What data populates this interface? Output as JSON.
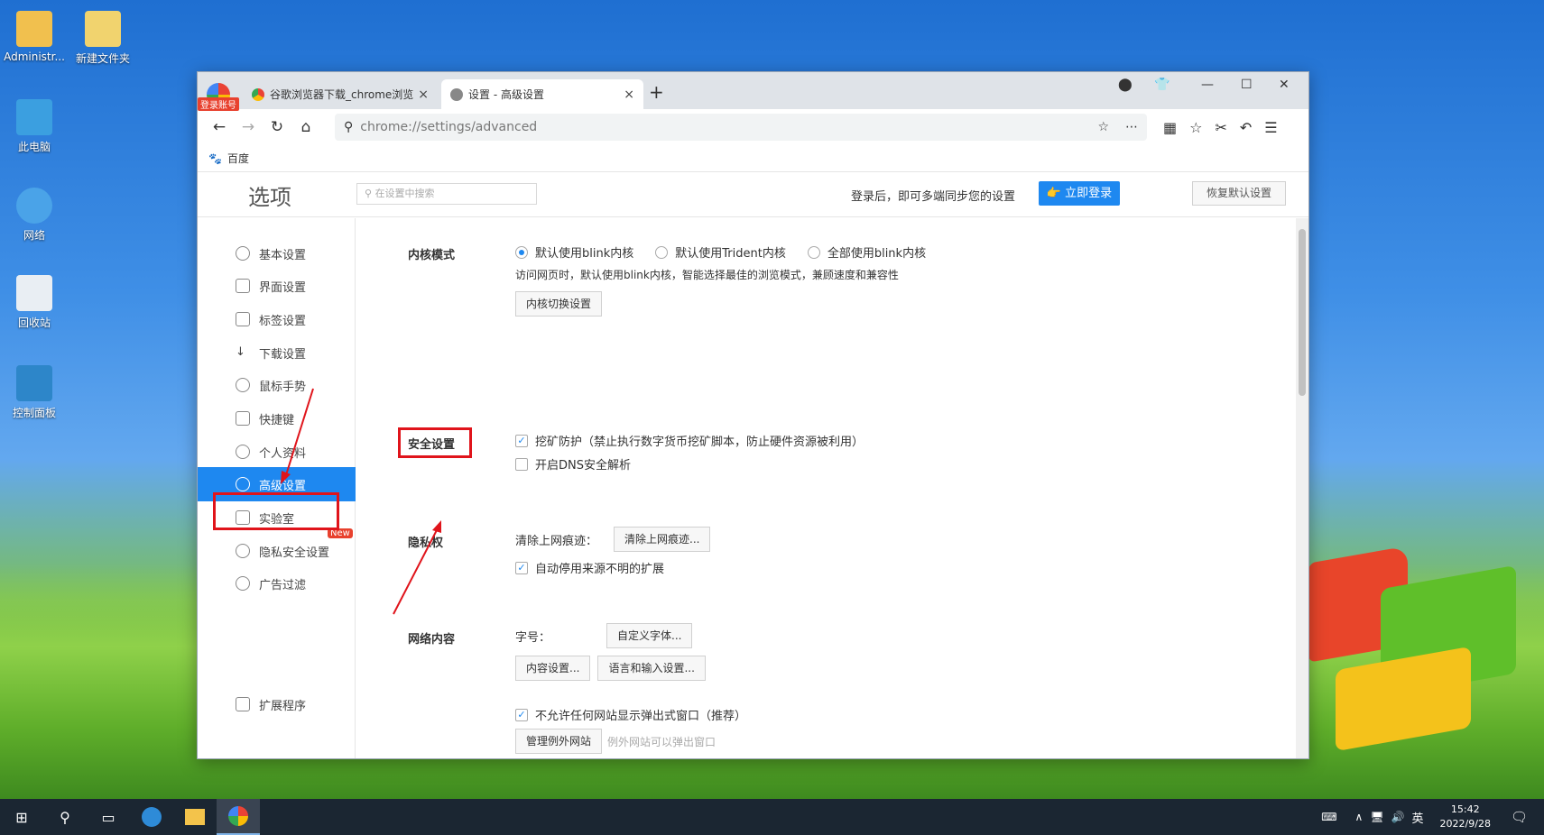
{
  "desktop": {
    "icons": [
      {
        "label": "Administr..."
      },
      {
        "label": "新建文件夹"
      },
      {
        "label": "此电脑"
      },
      {
        "label": "网络"
      },
      {
        "label": "回收站"
      },
      {
        "label": "控制面板"
      }
    ]
  },
  "browser": {
    "login_badge": "登录账号",
    "tabs": [
      {
        "title": "谷歌浏览器下载_chrome浏览",
        "close": "×"
      },
      {
        "title": "设置 - 高级设置",
        "close": "×"
      }
    ],
    "new_tab": "+",
    "address": "chrome://settings/advanced",
    "bookmark": "百度"
  },
  "settings": {
    "title": "选项",
    "search_placeholder": "在设置中搜索",
    "sync_text": "登录后，即可多端同步您的设置",
    "login_button": "立即登录",
    "restore_button": "恢复默认设置",
    "sidebar": [
      {
        "label": "基本设置"
      },
      {
        "label": "界面设置"
      },
      {
        "label": "标签设置"
      },
      {
        "label": "下载设置"
      },
      {
        "label": "鼠标手势"
      },
      {
        "label": "快捷键"
      },
      {
        "label": "个人资料"
      },
      {
        "label": "高级设置"
      },
      {
        "label": "实验室"
      },
      {
        "label": "隐私安全设置"
      },
      {
        "label": "广告过滤"
      }
    ],
    "new_badge": "New",
    "extensions": "扩展程序",
    "kernel": {
      "title": "内核模式",
      "opt1": "默认使用blink内核",
      "opt2": "默认使用Trident内核",
      "opt3": "全部使用blink内核",
      "desc": "访问网页时，默认使用blink内核，智能选择最佳的浏览模式，兼顾速度和兼容性",
      "button": "内核切换设置"
    },
    "security": {
      "title": "安全设置",
      "mining": "挖矿防护（禁止执行数字货币挖矿脚本，防止硬件资源被利用）",
      "dns": "开启DNS安全解析"
    },
    "privacy": {
      "title": "隐私权",
      "clear_label": "清除上网痕迹：",
      "clear_button": "清除上网痕迹...",
      "auto_disable": "自动停用来源不明的扩展"
    },
    "web": {
      "title": "网络内容",
      "font_label": "字号：",
      "font_button": "自定义字体...",
      "content_button": "内容设置...",
      "lang_button": "语言和输入设置...",
      "popup": "不允许任何网站显示弹出式窗口（推荐）",
      "exceptions_button": "管理例外网站",
      "exceptions_hint": "例外网站可以弹出窗口"
    }
  },
  "taskbar": {
    "ime": "英",
    "time": "15:42",
    "date": "2022/9/28"
  }
}
